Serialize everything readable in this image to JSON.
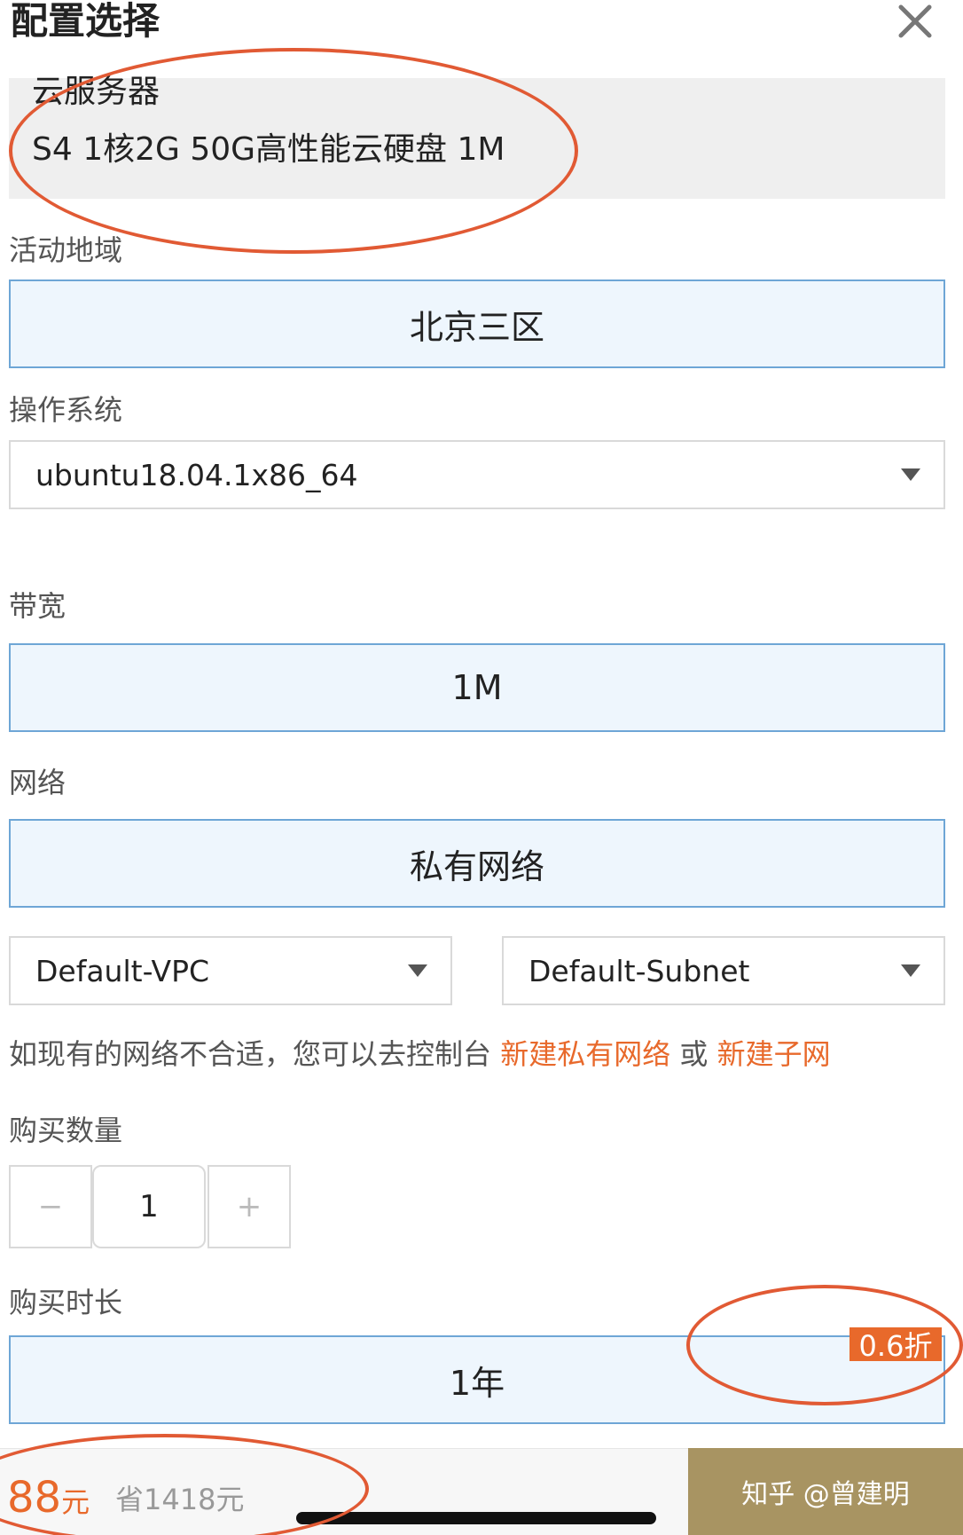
{
  "header": {
    "title": "配置选择",
    "close_icon": "close-icon"
  },
  "product": {
    "category": "云服务器",
    "spec": "S4 1核2G 50G高性能云硬盘 1M"
  },
  "region": {
    "label": "活动地域",
    "value": "北京三区"
  },
  "os": {
    "label": "操作系统",
    "value": "ubuntu18.04.1x86_64"
  },
  "bandwidth": {
    "label": "带宽",
    "value": "1M"
  },
  "network": {
    "label": "网络",
    "value": "私有网络",
    "vpc": "Default-VPC",
    "subnet": "Default-Subnet",
    "hint_prefix": "如现有的网络不合适，您可以去控制台",
    "link_vpc": "新建私有网络",
    "hint_or": "或",
    "link_subnet": "新建子网"
  },
  "quantity": {
    "label": "购买数量",
    "minus": "−",
    "value": "1",
    "plus": "+"
  },
  "duration": {
    "label": "购买时长",
    "value": "1年",
    "discount_badge": "0.6折"
  },
  "footer": {
    "price": "88",
    "price_unit": "元",
    "saving": "省1418元",
    "watermark": "知乎 @曾建明"
  },
  "colors": {
    "accent": "#e8692b",
    "selected_bg": "#eef6fd",
    "selected_border": "#6ea6d6",
    "buy_button": "#a89462",
    "annotation": "#e15a34"
  }
}
